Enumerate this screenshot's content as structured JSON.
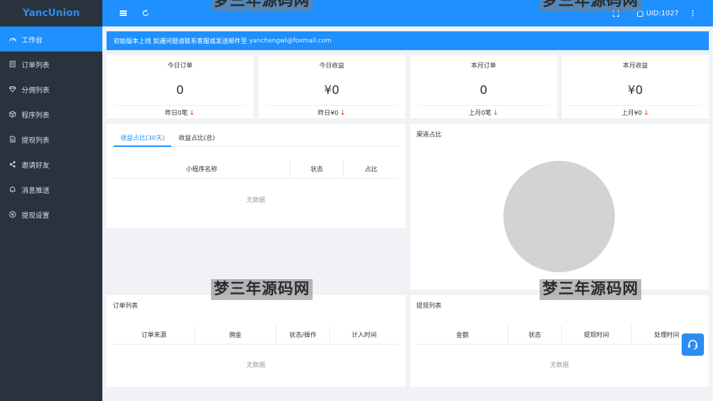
{
  "brand": "YancUnion",
  "sidebar": {
    "items": [
      {
        "label": "工作台",
        "icon": "dashboard-icon"
      },
      {
        "label": "订单列表",
        "icon": "list-icon"
      },
      {
        "label": "分佣列表",
        "icon": "diamond-icon"
      },
      {
        "label": "程序列表",
        "icon": "cube-icon"
      },
      {
        "label": "提现列表",
        "icon": "document-icon"
      },
      {
        "label": "邀请好友",
        "icon": "share-icon"
      },
      {
        "label": "消息推送",
        "icon": "bell-icon"
      },
      {
        "label": "提现设置",
        "icon": "money-icon"
      }
    ]
  },
  "header": {
    "user": "UID:1027"
  },
  "notice": {
    "text": "初始版本上线 如遇问题请联系客服或发送邮件至",
    "email": "yanchengwl@foxmail.com"
  },
  "stats": [
    {
      "title": "今日订单",
      "value": "0",
      "foot": "昨日0笔"
    },
    {
      "title": "今日收益",
      "value": "¥0",
      "foot": "昨日¥0"
    },
    {
      "title": "本月订单",
      "value": "0",
      "foot": "上月0笔"
    },
    {
      "title": "本月收益",
      "value": "¥0",
      "foot": "上月¥0"
    }
  ],
  "revenue": {
    "tabs": [
      "收益占比(30天)",
      "收益占比(总)"
    ],
    "columns": [
      "小程序名称",
      "状态",
      "占比"
    ],
    "empty": "无数据"
  },
  "channel": {
    "title": "渠道占比"
  },
  "orders": {
    "title": "订单列表",
    "columns": [
      "订单来源",
      "佣金",
      "状态/操作",
      "计入时间"
    ],
    "empty": "无数据"
  },
  "withdrawals": {
    "title": "提现列表",
    "columns": [
      "金额",
      "状态",
      "提现时间",
      "处理时间"
    ],
    "empty": "无数据"
  },
  "watermark": "梦三年源码网",
  "colors": {
    "accent": "#1e90ff",
    "sidebar": "#28333e",
    "down_arrow": "#ed4014",
    "pie_fill": "#d3d3d3"
  }
}
